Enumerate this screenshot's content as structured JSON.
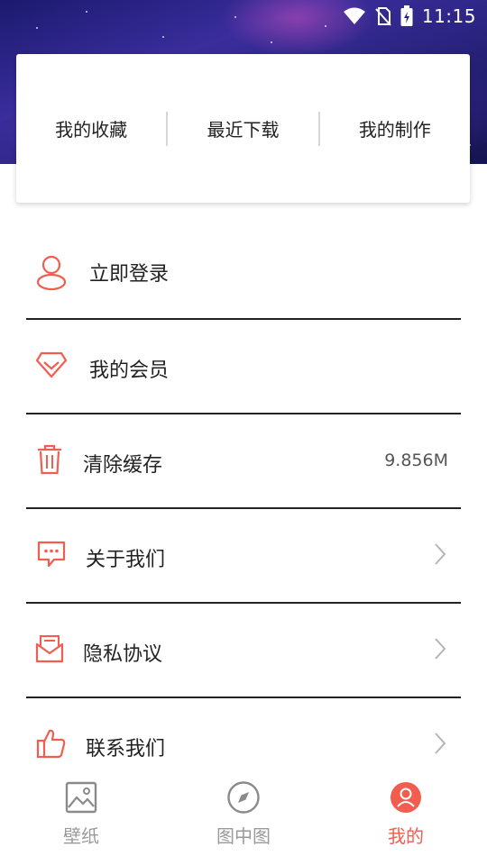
{
  "status_bar": {
    "time": "11:15"
  },
  "top_card": {
    "items": [
      {
        "label": "我的收藏"
      },
      {
        "label": "最近下载"
      },
      {
        "label": "我的制作"
      }
    ]
  },
  "menu": {
    "items": [
      {
        "label": "立即登录",
        "icon": "user-icon"
      },
      {
        "label": "我的会员",
        "icon": "diamond-icon"
      },
      {
        "label": "清除缓存",
        "icon": "trash-icon",
        "value": "9.856M"
      },
      {
        "label": "关于我们",
        "icon": "chat-bubble-icon"
      },
      {
        "label": "隐私协议",
        "icon": "envelope-icon"
      },
      {
        "label": "联系我们",
        "icon": "thumbs-up-icon"
      }
    ]
  },
  "tabbar": {
    "tabs": [
      {
        "label": "壁纸",
        "icon": "image-icon"
      },
      {
        "label": "图中图",
        "icon": "compass-icon"
      },
      {
        "label": "我的",
        "icon": "profile-icon",
        "active": true
      }
    ]
  },
  "colors": {
    "accent": "#f25d4f",
    "inactive": "#9a9a9a"
  }
}
